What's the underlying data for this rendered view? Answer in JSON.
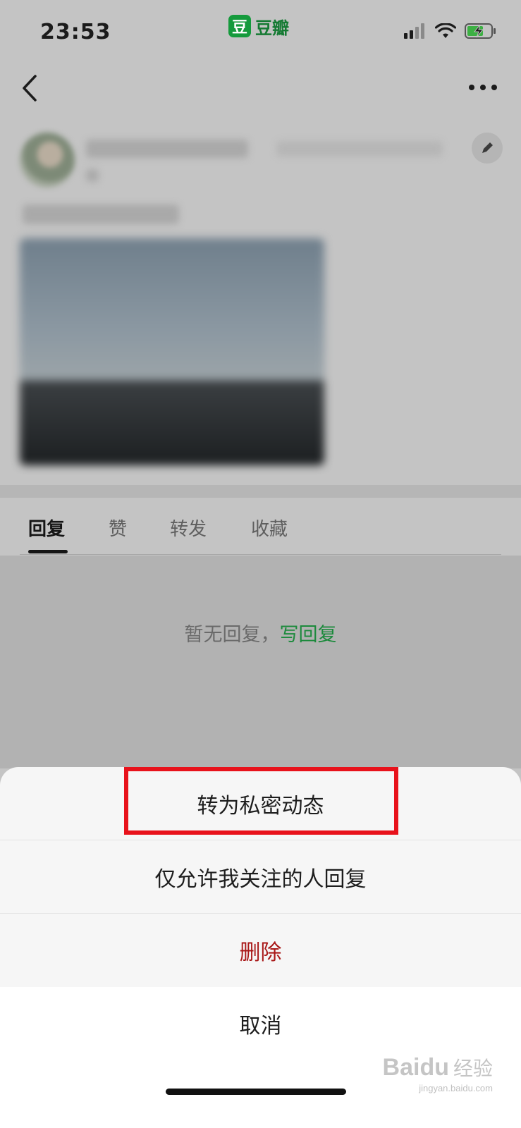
{
  "status_bar": {
    "time": "23:53",
    "app_logo_char": "豆",
    "app_name": "豆瓣"
  },
  "nav": {
    "back_icon": "chevron-left-icon",
    "more_icon": "ellipsis-icon"
  },
  "tabs": [
    {
      "label": "回复",
      "active": true
    },
    {
      "label": "赞",
      "active": false
    },
    {
      "label": "转发",
      "active": false
    },
    {
      "label": "收藏",
      "active": false
    }
  ],
  "empty_state": {
    "text": "暂无回复，",
    "link": "写回复"
  },
  "sheet": {
    "items": [
      {
        "label": "转为私密动态"
      },
      {
        "label": "仅允许我关注的人回复"
      },
      {
        "label": "删除",
        "danger": true
      }
    ],
    "cancel": "取消"
  },
  "watermark": {
    "brand": "Baidu",
    "cn": "经验",
    "url": "jingyan.baidu.com"
  },
  "colors": {
    "accent_green": "#1c8a3c",
    "danger": "#a91818",
    "highlight": "#e8121b"
  }
}
